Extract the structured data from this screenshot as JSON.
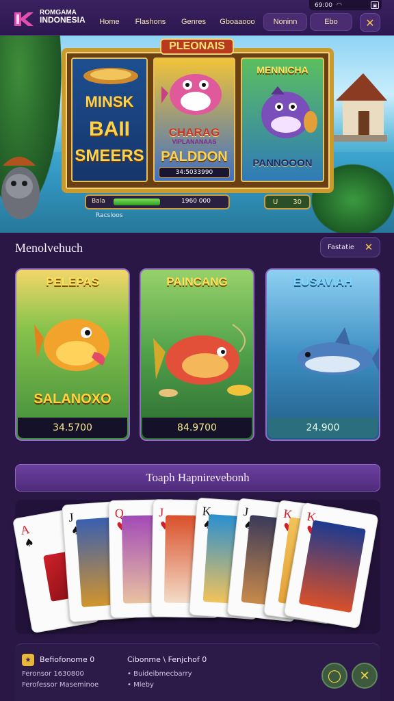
{
  "header": {
    "brand_line1": "ROMGAMA",
    "brand_line2": "INDONESIA",
    "nav": [
      "Home",
      "Flashons",
      "Genres",
      "Gboaaooo",
      "Noninn",
      "Ebo"
    ],
    "close_icon": "close-icon",
    "status_text": "69:00"
  },
  "hero": {
    "banner_title": "PLEONAIS",
    "reel1_top": "MINSK",
    "reel1_mid": "BAII",
    "reel1_bottom": "SMEERS",
    "reel2_mid": "CHARAG",
    "reel2_sub": "VIPLANANAAS",
    "reel2_bottom": "PALDDON",
    "reel2_bar": "34:5033990",
    "reel3_top": "MENNICHA",
    "reel3_bottom": "PANNOOON",
    "balance_label": "Bala",
    "balance_value": "1960 000",
    "balance_fill": 0.45,
    "bet_label": "U",
    "bet_value": "30",
    "caption": "Racsloos"
  },
  "section": {
    "title": "Menolvehuch",
    "pill_label": "Fastatie",
    "games": [
      {
        "title": "PELEPAS",
        "subtitle": "SALANOXO",
        "price": "34.5700"
      },
      {
        "title": "PAINCANG",
        "subtitle": "",
        "price": "84.9700"
      },
      {
        "title": "EUSAVIAH",
        "subtitle": "",
        "price": "24.900"
      }
    ]
  },
  "cards": {
    "banner": "Toaph Hapnirevebonh",
    "ranks": [
      "A",
      "J",
      "Q",
      "J",
      "K",
      "J",
      "K",
      "K"
    ]
  },
  "footer": {
    "left_title": "Befiofonome 0",
    "left_line1": "Feronsor 1630800",
    "left_line2": "Ferofessor Maseminoe",
    "mid_title": "Cibonme \\ Fenjchof 0",
    "mid_line1": "Buideibmecbarry",
    "mid_line2": "Mleby"
  },
  "colors": {
    "background": "#2a1746",
    "accent": "#f5c64a",
    "gold": "#c99b2e"
  }
}
